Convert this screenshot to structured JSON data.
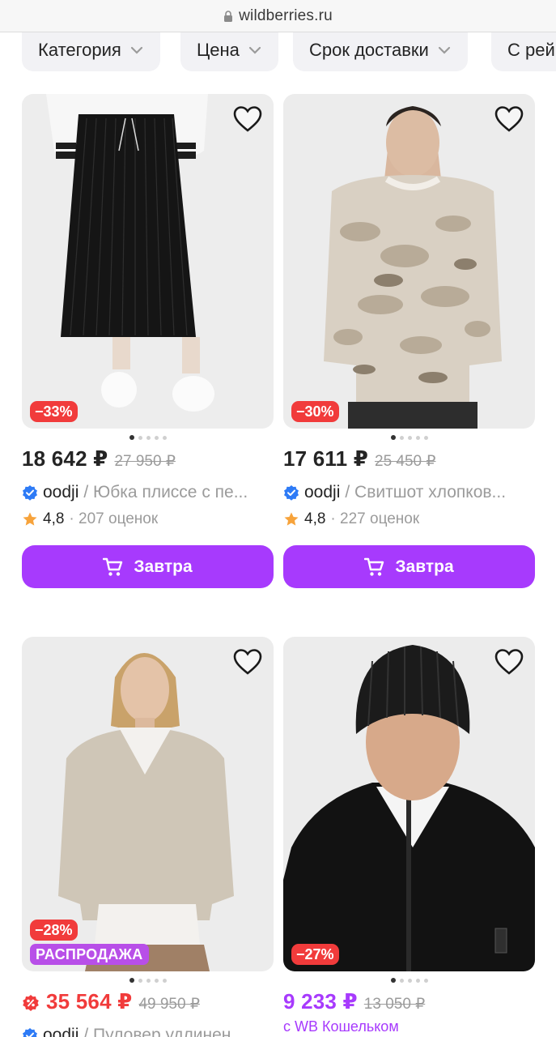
{
  "browser": {
    "url": "wildberries.ru"
  },
  "filters": [
    {
      "label": "Категория"
    },
    {
      "label": "Цена"
    },
    {
      "label": "Срок доставки"
    },
    {
      "label": "С рей"
    }
  ],
  "products": [
    {
      "discount": "−33%",
      "price": "18 642 ₽",
      "old_price": "27 950 ₽",
      "brand": "oodji",
      "name": "/ Юбка плиссе с пе...",
      "rating": "4,8",
      "reviews": "· 207 оценок",
      "button": "Завтра",
      "photo_dots": 5
    },
    {
      "discount": "−30%",
      "price": "17 611 ₽",
      "old_price": "25 450 ₽",
      "brand": "oodji",
      "name": "/ Свитшот хлопков...",
      "rating": "4,8",
      "reviews": "· 227 оценок",
      "button": "Завтра",
      "photo_dots": 5
    },
    {
      "discount": "−28%",
      "sale_badge": "РАСПРОДАЖА",
      "price": "35 564 ₽",
      "old_price": "49 950 ₽",
      "brand": "oodji",
      "name": "/ Пуловер удлинен...",
      "photo_dots": 5
    },
    {
      "discount": "−27%",
      "price": "9 233 ₽",
      "old_price": "13 050 ₽",
      "wallet_note": "с WB Кошельком",
      "photo_dots": 5
    }
  ],
  "colors": {
    "accent": "#a73afd",
    "discount": "#f13b3b",
    "sale": "#b84fe8",
    "muted": "#9b9b9b"
  }
}
